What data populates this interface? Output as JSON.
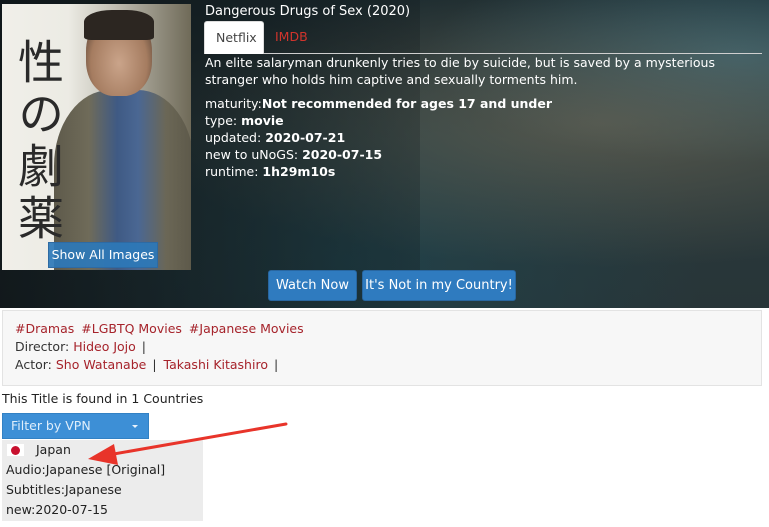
{
  "title": "Dangerous Drugs of Sex (2020)",
  "poster": {
    "kanji": "性の劇薬",
    "show_images_label": "Show All Images"
  },
  "tabs": {
    "netflix": "Netflix",
    "imdb": "IMDB"
  },
  "synopsis": "An elite salaryman drunkenly tries to die by suicide, but is saved by a mysterious stranger who holds him captive and sexually torments him.",
  "meta": {
    "maturity_label": "maturity:",
    "maturity_value": "Not recommended for ages 17 and under",
    "type_label": "type:",
    "type_value": "movie",
    "updated_label": "updated:",
    "updated_value": "2020-07-21",
    "new_label": "new to uNoGS:",
    "new_value": "2020-07-15",
    "runtime_label": "runtime:",
    "runtime_value": "1h29m10s"
  },
  "buttons": {
    "watch_now": "Watch Now",
    "not_in_country": "It's Not in my Country!"
  },
  "info": {
    "tags": [
      "#Dramas",
      "#LGBTQ Movies",
      "#Japanese Movies"
    ],
    "director_label": "Director:",
    "director": "Hideo Jojo",
    "actor_label": "Actor:",
    "actors": [
      "Sho Watanabe",
      "Takashi Kitashiro"
    ],
    "separator": "|"
  },
  "found_text": "This Title is found in 1 Countries",
  "filter": {
    "placeholder": "Filter by VPN"
  },
  "country": {
    "name": "Japan",
    "flag": "japan-flag-icon",
    "audio": "Audio:Japanese [Original]",
    "subtitles": "Subtitles:Japanese",
    "new": "new:2020-07-15"
  },
  "colors": {
    "button_blue": "#2f7bbf",
    "link_red": "#a6232b",
    "imdb_red": "#d0342c",
    "arrow_red": "#e8342a"
  }
}
